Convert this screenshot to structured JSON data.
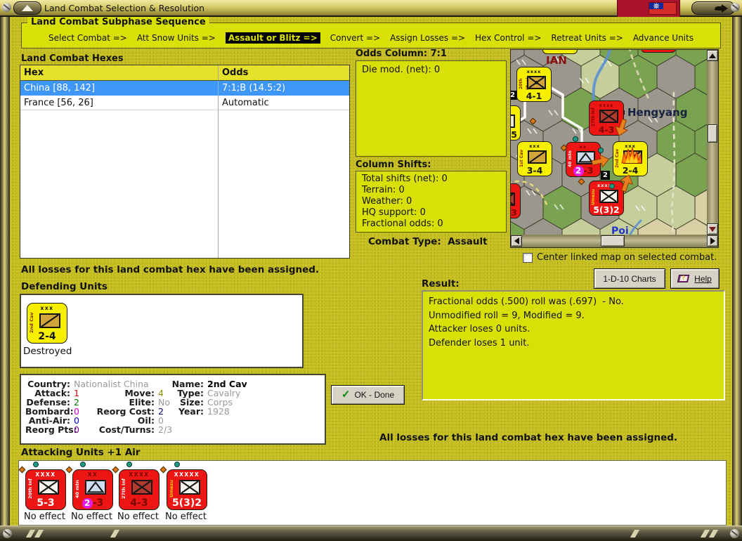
{
  "colors": {
    "page_bg": "#c5be1d",
    "panel_yellow": "#d9e007",
    "table_header_yellow": "#e6e22c",
    "selection_blue": "#3e97f7",
    "counter_red": "#ee1515",
    "counter_yellow": "#f6ef00",
    "flag_red": "#a8132b",
    "button_face": "#d6d2c6"
  },
  "titlebar": {
    "title": "Land Combat Selection & Resolution"
  },
  "sequence": {
    "title": "Land Combat Subphase Sequence",
    "steps": [
      {
        "label": "Select Combat =>",
        "active": false
      },
      {
        "label": "Att Snow Units =>",
        "active": false
      },
      {
        "label": "Assault or Blitz =>",
        "active": true
      },
      {
        "label": "Convert =>",
        "active": false
      },
      {
        "label": "Assign Losses =>",
        "active": false
      },
      {
        "label": "Hex Control =>",
        "active": false
      },
      {
        "label": "Retreat Units =>",
        "active": false
      },
      {
        "label": "Advance Units",
        "active": false
      }
    ]
  },
  "hexes": {
    "title": "Land Combat Hexes",
    "columns": [
      "Hex",
      "Odds"
    ],
    "rows": [
      {
        "hex": "China [88, 142]",
        "odds": "7:1;B (14.5:2)",
        "selected": true
      },
      {
        "hex": "France [56, 26]",
        "odds": "Automatic",
        "selected": false
      }
    ]
  },
  "odds": {
    "title": "Odds Column: 7:1",
    "die_mod": "Die mod. (net): 0"
  },
  "shifts": {
    "title": "Column Shifts:",
    "lines": [
      "Total shifts (net): 0",
      "Terrain: 0",
      "Weather: 0",
      "HQ support: 0",
      "Fractional odds: 0"
    ]
  },
  "combat_type": {
    "label": "Combat Type:",
    "value": "Assault"
  },
  "map": {
    "region_label": "IAN",
    "city_label": "Hengyang",
    "city_label_2": "Poi",
    "hex_badge": "2",
    "checkbox_label": "Center linked map on selected combat.",
    "checkbox_checked": false,
    "units": [
      {
        "name": "20th (Res)",
        "size": "xxxx",
        "stats": "4-1",
        "side": "yellow",
        "symbol": "garrison"
      },
      {
        "name": "",
        "size": "",
        "stats": "-5",
        "side": "yellow",
        "symbol": "infantry",
        "partial": true
      },
      {
        "name": "27th Inf",
        "size": "xxxx",
        "stats": "4-3",
        "side": "red",
        "symbol": "infantry"
      },
      {
        "name": "1st Cav",
        "size": "xxx",
        "stats": "3-4",
        "side": "yellow",
        "symbol": "cavalry"
      },
      {
        "name": "40 mtn",
        "size": "xx",
        "stats": "-3",
        "stat_badge": "2",
        "side": "red",
        "symbol": "mountain"
      },
      {
        "name": "2nd Cav",
        "size": "xxx",
        "stats": "2-4",
        "side": "yellow",
        "symbol": "cavalry",
        "burning": true
      },
      {
        "name": "Umezu",
        "size": "xxxxx",
        "stats": "5(3)2",
        "side": "red",
        "symbol": "hq"
      },
      {
        "name": "",
        "size": "",
        "stats": "-3",
        "side": "red",
        "symbol": "infantry",
        "partial": true
      }
    ]
  },
  "buttons": {
    "charts": "1-D-10 Charts",
    "help": "Help",
    "ok": "OK - Done"
  },
  "messages": {
    "losses_left": "All losses for this land combat hex have been assigned.",
    "losses_right": "All losses for this land combat hex have been assigned."
  },
  "defending": {
    "title": "Defending Units",
    "unit": {
      "name": "2nd Cav",
      "size": "xxx",
      "stats": "2-4",
      "status": "Destroyed"
    }
  },
  "unit_info": {
    "col1": [
      {
        "label": "Country:",
        "value": "Nationalist China",
        "color": "#9a9a9a"
      },
      {
        "label": "Attack:",
        "value": "1",
        "color": "#d40000"
      },
      {
        "label": "Defense:",
        "value": "2",
        "color": "#007800"
      },
      {
        "label": "Bombard:",
        "value": "0",
        "color": "#d400d4"
      },
      {
        "label": "Anti-Air:",
        "value": "0",
        "color": "#0000c8"
      },
      {
        "label": "Reorg Pts:",
        "value": "0",
        "color": "#7a0096"
      }
    ],
    "col2": [
      {
        "label": "Move:",
        "value": "4",
        "color": "#8a8a00"
      },
      {
        "label": "Elite:",
        "value": "No",
        "color": "#9a9a9a"
      },
      {
        "label": "Reorg Cost:",
        "value": "2",
        "color": "#000078"
      },
      {
        "label": "Oil:",
        "value": "0",
        "color": "#9a9a9a"
      },
      {
        "label": "Cost/Turns:",
        "value": "2/3",
        "color": "#9a9a9a"
      }
    ],
    "col3": [
      {
        "label": "Name:",
        "value": "2nd Cav",
        "color": "#000000"
      },
      {
        "label": "Type:",
        "value": "Cavalry",
        "color": "#9a9a9a"
      },
      {
        "label": "Size:",
        "value": "Corps",
        "color": "#9a9a9a"
      },
      {
        "label": "Year:",
        "value": "1928",
        "color": "#9a9a9a"
      }
    ]
  },
  "result": {
    "title": "Result:",
    "lines": [
      "Fractional odds (.500) roll was (.697)  - No.",
      "Unmodified roll = 9, Modified = 9.",
      "Attacker loses 0 units.",
      "Defender loses 1 unit."
    ]
  },
  "attacking": {
    "title": "Attacking Units +1 Air",
    "units": [
      {
        "name": "20th Inf",
        "size": "XXXX",
        "stats": "5-3",
        "status": "No effect",
        "side": "red",
        "symbol": "infantry"
      },
      {
        "name": "40 mtn",
        "size": "XX",
        "stats": "-3",
        "stat_badge": "2",
        "status": "No effect",
        "side": "red",
        "symbol": "mountain"
      },
      {
        "name": "27th Inf",
        "size": "XXXX",
        "stats": "4-3",
        "status": "No effect",
        "side": "red",
        "symbol": "infantry"
      },
      {
        "name": "Umezu",
        "size": "XXXXX",
        "stats": "5(3)2",
        "status": "No effect",
        "side": "red",
        "symbol": "hq"
      }
    ]
  }
}
